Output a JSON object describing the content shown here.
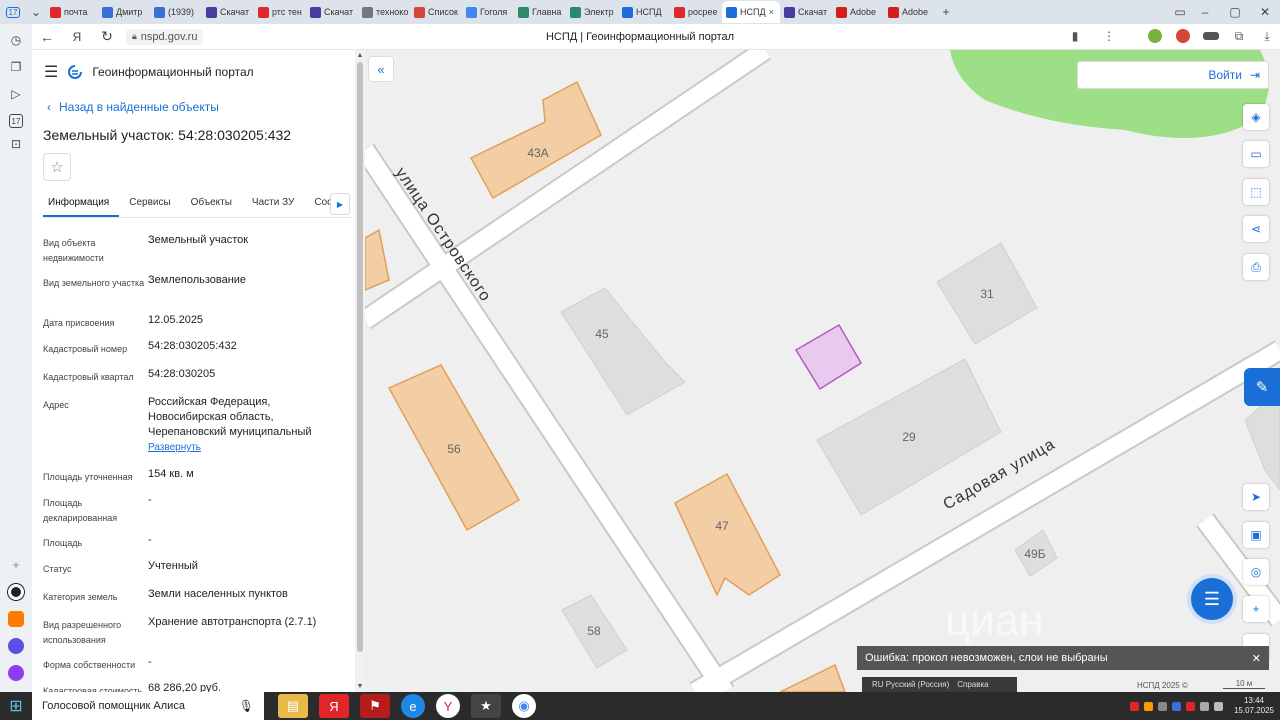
{
  "browser": {
    "tabs": [
      {
        "label": "почта",
        "color": "#e0262b"
      },
      {
        "label": "Дмитр",
        "color": "#3b6fd6"
      },
      {
        "label": "(1939)",
        "color": "#3b6fd6"
      },
      {
        "label": "Скачат",
        "color": "#4b3aa0"
      },
      {
        "label": "ртс тен",
        "color": "#e0262b"
      },
      {
        "label": "Скачат",
        "color": "#4b3aa0"
      },
      {
        "label": "техноко",
        "color": "#777777"
      },
      {
        "label": "Список",
        "color": "#d44638"
      },
      {
        "label": "Гоголя",
        "color": "#4285f4"
      },
      {
        "label": "Главна",
        "color": "#2a8a6a"
      },
      {
        "label": "Электр",
        "color": "#2a8a6a"
      },
      {
        "label": "НСПД",
        "color": "#1a6fd6"
      },
      {
        "label": "росрее",
        "color": "#e0262b"
      },
      {
        "label": "НСПД",
        "color": "#1a6fd6",
        "active": true
      },
      {
        "label": "Скачат",
        "color": "#4b3aa0"
      },
      {
        "label": "Adobe",
        "color": "#d81b1b"
      },
      {
        "label": "Adobe",
        "color": "#d81b1b"
      }
    ],
    "tab_count": "17",
    "close_symbol": "×",
    "new_tab": "+",
    "url": "nspd.gov.ru",
    "page_title": "НСПД | Геоинформационный портал",
    "sidebar_badge": "17"
  },
  "panel": {
    "portal_title": "Геоинформационный портал",
    "back_label": "Назад в найденные объекты",
    "title": "Земельный участок: 54:28:030205:432",
    "tabs": [
      "Информация",
      "Сервисы",
      "Объекты",
      "Части ЗУ",
      "Состав"
    ],
    "fields": [
      {
        "label": "Вид объекта недвижимости",
        "value": "Земельный участок"
      },
      {
        "label": "Вид земельного участка",
        "value": "Землепользование"
      },
      {
        "label": "Дата присвоения",
        "value": "12.05.2025"
      },
      {
        "label": "Кадастровый номер",
        "value": "54:28:030205:432"
      },
      {
        "label": "Кадастровый квартал",
        "value": "54:28:030205"
      },
      {
        "label": "Адрес",
        "value": "Российская Федерация, Новосибирская область, Черепановский муниципальный",
        "link": "Развернуть"
      },
      {
        "label": "Площадь уточненная",
        "value": "154 кв. м"
      },
      {
        "label": "Площадь декларированная",
        "value": "-"
      },
      {
        "label": "Площадь",
        "value": "-"
      },
      {
        "label": "Статус",
        "value": "Учтенный"
      },
      {
        "label": "Категория земель",
        "value": "Земли населенных пунктов"
      },
      {
        "label": "Вид разрешенного использования",
        "value": "Хранение автотранспорта (2.7.1)"
      },
      {
        "label": "Форма собственности",
        "value": "-"
      },
      {
        "label": "Кадастровая стоимость",
        "value": "68 286,20 руб."
      }
    ]
  },
  "map": {
    "login": "Войти",
    "streets": {
      "ostrovskogo": "улица Островского",
      "sadovaya": "Садовая улица"
    },
    "buildings": {
      "b43a": "43А",
      "b56": "56",
      "b47": "47",
      "b45": "45",
      "b31": "31",
      "b29": "29",
      "b49b": "49Б",
      "b58": "58"
    },
    "toast": "Ошибка: прокол невозможен, слои не выбраны",
    "toast_close": "✕",
    "lang": "RU Русский (Россия)",
    "help": "Справка",
    "copyright": "НСПД 2025 ©",
    "scale": "10 м",
    "watermark": "циан",
    "colors": {
      "orange_fill": "#f3cda3",
      "orange_stroke": "#e0a05a",
      "grey_fill": "#dedede",
      "parcel_fill": "#eac9ee",
      "parcel_stroke": "#b05cc0",
      "park": "#9ddf86",
      "accent": "#1a6fd6"
    }
  },
  "taskbar": {
    "assistant": "Голосовой помощник Алиса",
    "time": "13:44",
    "date": "15.07.2025"
  }
}
